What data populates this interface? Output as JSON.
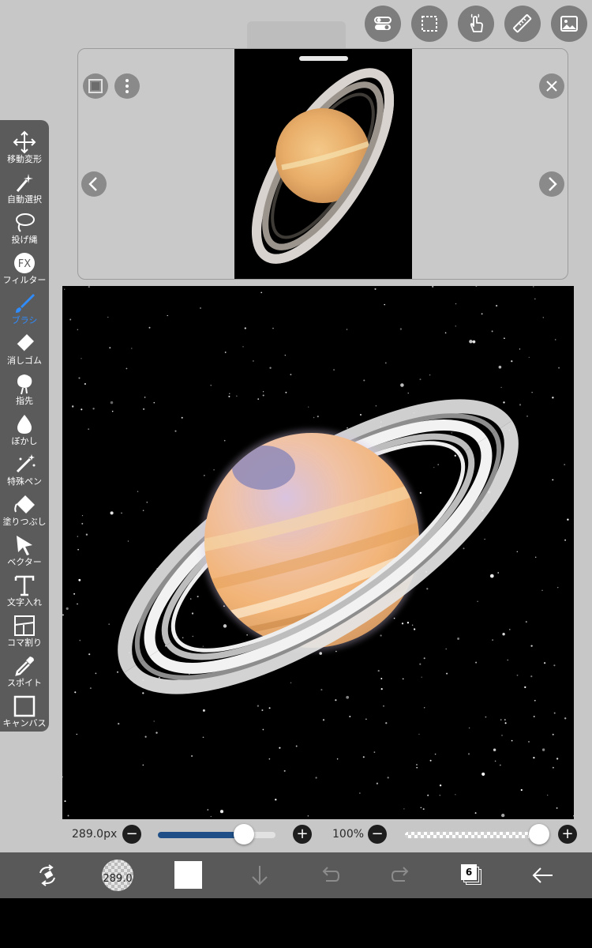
{
  "app": {
    "accent_color": "#2f8cff",
    "toolbar_bg": "#595959",
    "canvas_bg": "#000000"
  },
  "top_toolbar": {
    "buttons": [
      {
        "icon": "toggle-icon"
      },
      {
        "icon": "selection-icon"
      },
      {
        "icon": "hand-gesture-icon"
      },
      {
        "icon": "ruler-icon"
      },
      {
        "icon": "material-image-icon"
      }
    ]
  },
  "reference_panel": {
    "icons": [
      "menu-square-icon",
      "more-vertical-icon",
      "close-icon",
      "chevron-left-icon",
      "chevron-right-icon"
    ]
  },
  "tools": [
    {
      "label": "移動変形",
      "icon": "move-transform-icon",
      "active": false
    },
    {
      "label": "自動選択",
      "icon": "magic-wand-icon",
      "active": false
    },
    {
      "label": "投げ縄",
      "icon": "lasso-icon",
      "active": false
    },
    {
      "label": "フィルター",
      "icon": "fx-filter-icon",
      "active": false
    },
    {
      "label": "ブラシ",
      "icon": "brush-icon",
      "active": true
    },
    {
      "label": "消しゴム",
      "icon": "eraser-icon",
      "active": false
    },
    {
      "label": "指先",
      "icon": "finger-smudge-icon",
      "active": false
    },
    {
      "label": "ぼかし",
      "icon": "blur-drop-icon",
      "active": false
    },
    {
      "label": "特殊ペン",
      "icon": "special-pen-icon",
      "active": false
    },
    {
      "label": "塗りつぶし",
      "icon": "bucket-fill-icon",
      "active": false
    },
    {
      "label": "ベクター",
      "icon": "vector-cursor-icon",
      "active": false
    },
    {
      "label": "文字入れ",
      "icon": "text-icon",
      "active": false
    },
    {
      "label": "コマ割り",
      "icon": "panel-divide-icon",
      "active": false
    },
    {
      "label": "スポイト",
      "icon": "eyedropper-icon",
      "active": false
    },
    {
      "label": "キャンバス",
      "icon": "canvas-icon",
      "active": false
    }
  ],
  "brush_size": {
    "value_text": "289.0px",
    "minus": "−",
    "plus": "+",
    "fraction": 0.73,
    "color": "#1f4f86"
  },
  "brush_opacity": {
    "value_text": "100%",
    "minus": "−",
    "plus": "+",
    "fraction": 1.0
  },
  "bottom_bar": {
    "brush_size_label": "289.0",
    "layer_count": "6",
    "current_color": "#ffffff",
    "icons": [
      "swap-arrows-icon",
      "brush-preview-icon",
      "color-swatch-icon",
      "download-arrow-icon",
      "undo-icon",
      "redo-icon",
      "layers-icon",
      "back-arrow-icon"
    ]
  }
}
